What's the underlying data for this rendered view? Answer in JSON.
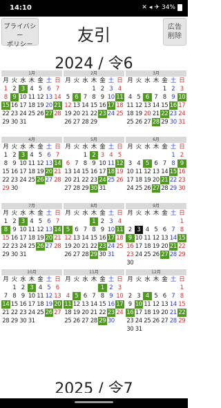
{
  "status": {
    "time": "14:10",
    "battery": "34%"
  },
  "header": {
    "privacy_line1": "プライバシー",
    "privacy_line2": "ポリシー",
    "title": "友引",
    "ad_line1": "広告",
    "ad_line2": "削除"
  },
  "year_title": "2024 / 令6",
  "next_year_title": "2025 / 令7",
  "weekdays": [
    "月",
    "火",
    "水",
    "木",
    "金",
    "土",
    "日"
  ],
  "colors": {
    "highlight": "#4f9a1e",
    "today": "#111111",
    "saturday": "#2c3bd4",
    "sunday": "#d22b2b",
    "month_header": "#d9d9d9"
  },
  "months": [
    {
      "label": "1月",
      "start": 0,
      "days": 31,
      "highlight": [
        3,
        9,
        15,
        21,
        27
      ],
      "holiday": [
        1,
        8
      ],
      "today": []
    },
    {
      "label": "2月",
      "start": 3,
      "days": 29,
      "highlight": [
        6,
        11,
        17,
        23
      ],
      "holiday": [
        11,
        12,
        23
      ],
      "today": []
    },
    {
      "label": "3月",
      "start": 4,
      "days": 31,
      "highlight": [
        6,
        10,
        16,
        22,
        28
      ],
      "holiday": [
        20
      ],
      "today": []
    },
    {
      "label": "4月",
      "start": 0,
      "days": 30,
      "highlight": [
        3,
        14,
        20,
        26
      ],
      "holiday": [
        29
      ],
      "today": []
    },
    {
      "label": "5月",
      "start": 2,
      "days": 31,
      "highlight": [
        2,
        12,
        18,
        24,
        30
      ],
      "holiday": [
        3,
        4,
        5,
        6
      ],
      "today": []
    },
    {
      "label": "6月",
      "start": 5,
      "days": 30,
      "highlight": [
        5,
        9,
        15,
        21,
        27
      ],
      "holiday": [],
      "today": []
    },
    {
      "label": "7月",
      "start": 0,
      "days": 31,
      "highlight": [
        3,
        8,
        14,
        20,
        26
      ],
      "holiday": [
        15
      ],
      "today": []
    },
    {
      "label": "8月",
      "start": 3,
      "days": 31,
      "highlight": [
        1,
        5,
        11,
        17,
        23,
        29
      ],
      "holiday": [
        11,
        12
      ],
      "today": []
    },
    {
      "label": "9月",
      "start": 6,
      "days": 30,
      "highlight": [
        9,
        15,
        21,
        27
      ],
      "holiday": [
        16,
        22,
        23
      ],
      "today": [
        3
      ]
    },
    {
      "label": "10月",
      "start": 1,
      "days": 31,
      "highlight": [
        3,
        14,
        20,
        26
      ],
      "holiday": [
        14
      ],
      "today": []
    },
    {
      "label": "11月",
      "start": 4,
      "days": 30,
      "highlight": [
        1,
        5,
        11,
        17,
        23,
        29
      ],
      "holiday": [
        3,
        4,
        23
      ],
      "today": []
    },
    {
      "label": "12月",
      "start": 6,
      "days": 31,
      "highlight": [
        4,
        10,
        16,
        22
      ],
      "holiday": [],
      "today": []
    }
  ]
}
